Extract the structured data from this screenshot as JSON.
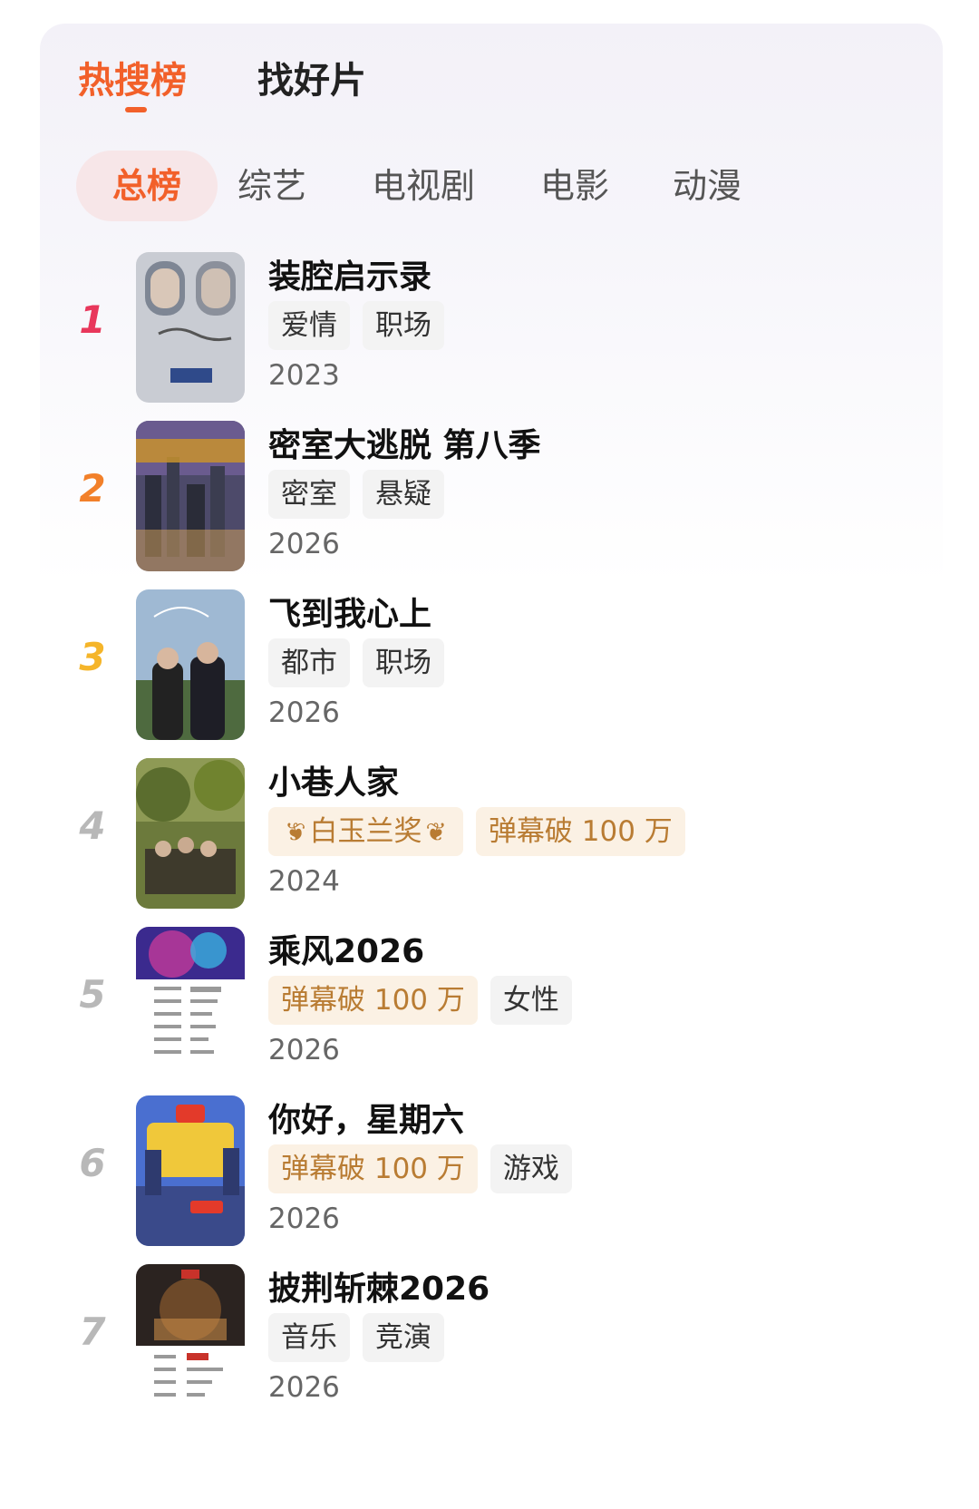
{
  "header": {
    "tabs": [
      {
        "label": "热搜榜",
        "active": true
      },
      {
        "label": "找好片",
        "active": false
      }
    ]
  },
  "categories": [
    {
      "label": "总榜",
      "active": true
    },
    {
      "label": "综艺",
      "active": false
    },
    {
      "label": "电视剧",
      "active": false
    },
    {
      "label": "电影",
      "active": false
    },
    {
      "label": "动漫",
      "active": false
    }
  ],
  "colors": {
    "accent": "#f2602a",
    "rank1": "#e8375b",
    "rank2": "#f2802a",
    "rank3": "#f5b52a",
    "rank_other": "#b8b8b8",
    "gold_tag_text": "#b97c33",
    "gold_tag_bg": "#fbf1e4"
  },
  "items": [
    {
      "rank": "1",
      "title": "装腔启示录",
      "tags": [
        {
          "text": "爱情"
        },
        {
          "text": "职场"
        }
      ],
      "year": "2023",
      "poster_icon": "poster-zhuangqiang"
    },
    {
      "rank": "2",
      "title": "密室大逃脱 第八季",
      "tags": [
        {
          "text": "密室"
        },
        {
          "text": "悬疑"
        }
      ],
      "year": "2026",
      "poster_icon": "poster-mishi"
    },
    {
      "rank": "3",
      "title": "飞到我心上",
      "tags": [
        {
          "text": "都市"
        },
        {
          "text": "职场"
        }
      ],
      "year": "2026",
      "poster_icon": "poster-feidao"
    },
    {
      "rank": "4",
      "title": "小巷人家",
      "tags": [
        {
          "text": "白玉兰奖",
          "style": "gold",
          "laurel": true
        },
        {
          "text": "弹幕破 100 万",
          "style": "gold"
        }
      ],
      "year": "2024",
      "poster_icon": "poster-xiaoxiang"
    },
    {
      "rank": "5",
      "title": "乘风2026",
      "tags": [
        {
          "text": "弹幕破 100 万",
          "style": "gold"
        },
        {
          "text": "女性"
        }
      ],
      "year": "2026",
      "poster_icon": "poster-chengfeng"
    },
    {
      "rank": "6",
      "title": "你好，星期六",
      "tags": [
        {
          "text": "弹幕破 100 万",
          "style": "gold"
        },
        {
          "text": "游戏"
        }
      ],
      "year": "2026",
      "poster_icon": "poster-nihao"
    },
    {
      "rank": "7",
      "title": "披荆斩棘2026",
      "tags": [
        {
          "text": "音乐"
        },
        {
          "text": "竞演"
        }
      ],
      "year": "2026",
      "poster_icon": "poster-pijing"
    }
  ]
}
